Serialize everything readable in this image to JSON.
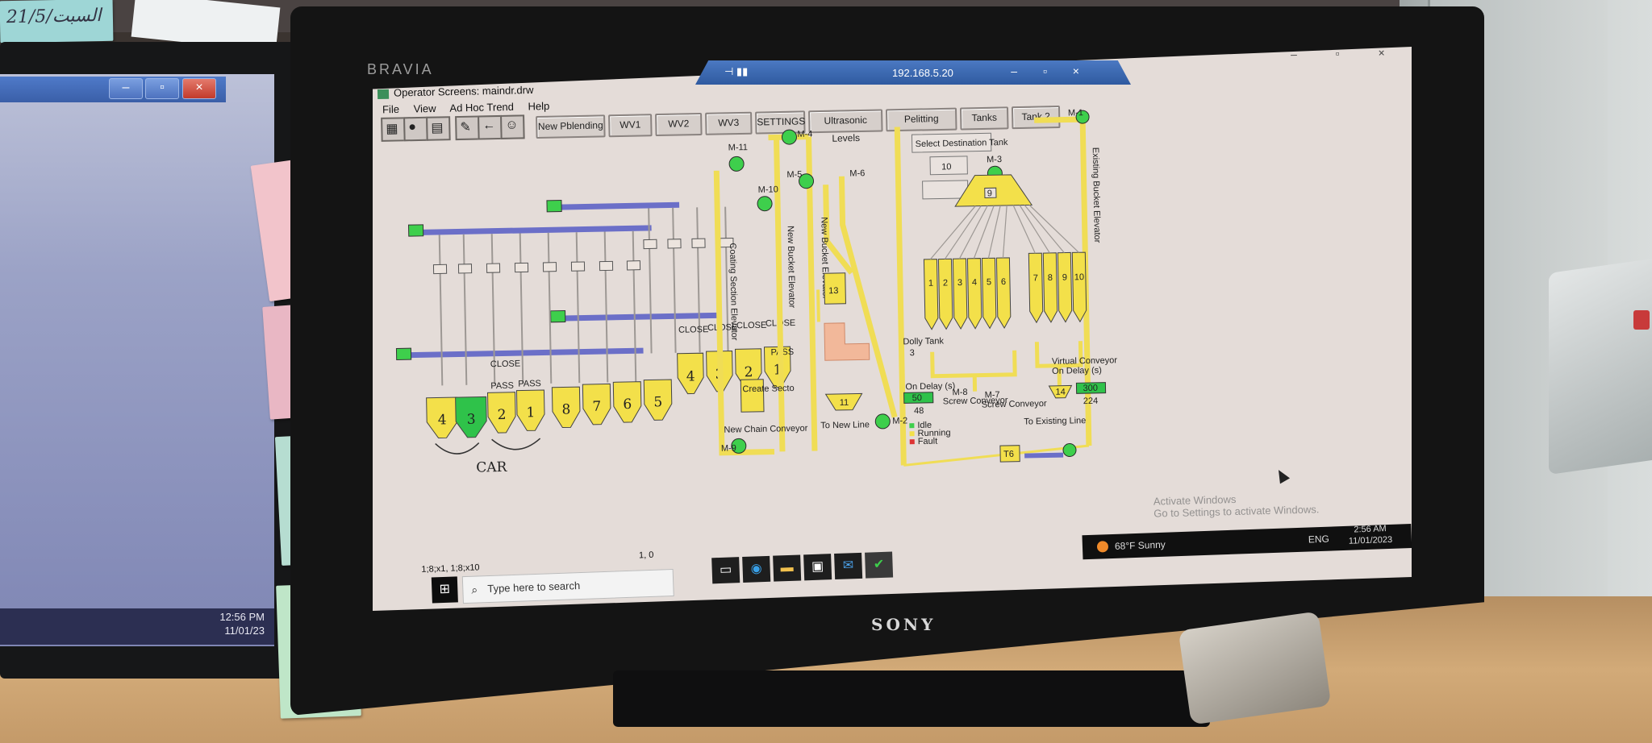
{
  "sticky_top_text": "21/5/السبت",
  "left_monitor": {
    "clock_time": "12:56 PM",
    "clock_date": "11/01/23"
  },
  "monitor_brand": "BRAVIA",
  "monitor_maker": "SONY",
  "rdp": {
    "host": "192.168.5.20",
    "controls": "– ▫ ×"
  },
  "app": {
    "title": "Operator Screens: maindr.drw",
    "window_controls": "– ▫ ×",
    "menu": [
      "File",
      "View",
      "Ad Hoc Trend",
      "Help"
    ],
    "toolbar_buttons": [
      "New Pblending",
      "WV1",
      "WV2",
      "WV3",
      "SETTINGS",
      "Ultrasonic Levels",
      "Pelitting",
      "Tanks",
      "Tank 2"
    ]
  },
  "scada": {
    "motors": [
      "M-11",
      "M-4",
      "M-10",
      "M-5",
      "M-6",
      "M-3",
      "M-9",
      "M-2",
      "M-8",
      "M-7",
      "M-1"
    ],
    "elevators": [
      "Coating Section Elevator",
      "New Bucket Elevator",
      "New Bucket Elevator",
      "Existing Bucket Elevator"
    ],
    "car_label": "CAR",
    "close_label": "CLOSE",
    "pass_label": "PASS",
    "hoppers_left": [
      "4",
      "3",
      "2",
      "1"
    ],
    "hoppers_mid": [
      "8",
      "7",
      "6",
      "5"
    ],
    "hoppers_right": [
      "4",
      "3",
      "2",
      "1"
    ],
    "tank_13": "13",
    "tank_11": "11",
    "tank_9": "9",
    "tanks_a": [
      "1",
      "2",
      "3",
      "4",
      "5",
      "6"
    ],
    "tanks_b": [
      "7",
      "8",
      "9",
      "10"
    ],
    "select_destination": "Select Destination Tank",
    "destination_value": "10",
    "dolly_tank": "Dolly Tank",
    "dolly_value": "3",
    "on_delay": "On Delay (s)",
    "on_delay_value": "50",
    "on_delay_value2": "48",
    "screw_conveyor": "Screw Conveyor",
    "value_14": "14",
    "value_300": "300",
    "value_224": "224",
    "virtual_conveyor": "Virtual Conveyor",
    "on_delay_right": "On Delay (s)",
    "to_existing_line": "To Existing Line",
    "to_new_line": "To New Line",
    "new_chain_conveyor": "New Chain Conveyor",
    "create_secto": "Create Secto",
    "legend": [
      "Idle",
      "Running",
      "Fault"
    ],
    "value_t6": "T6"
  },
  "win_taskbar": {
    "coords": "1;8;x1, 1;8;x10",
    "pos": "1, 0",
    "search_placeholder": "Type here to search",
    "weather": "68°F  Sunny",
    "lang": "ENG",
    "time": "2:56 AM",
    "date": "11/01/2023"
  },
  "activate": {
    "line1": "Activate Windows",
    "line2": "Go to Settings to activate Windows."
  },
  "colors": {
    "hopper_yellow": "#f3e04a",
    "hopper_active_green": "#2fc24a",
    "motor_green": "#3ecf4c",
    "pipe_yellow": "#f0dd55",
    "conveyor_blue": "#6b6fc8",
    "screen_bg": "#e4dcd8",
    "tank13_salmon": "#f2b89a"
  }
}
